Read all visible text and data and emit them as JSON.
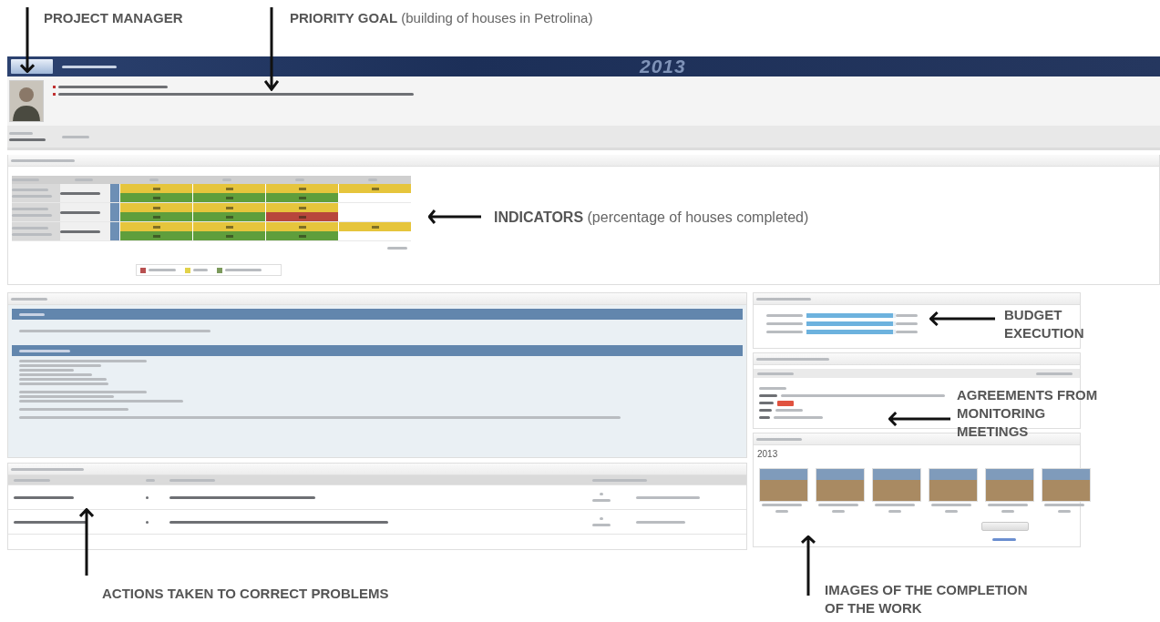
{
  "annotations": [
    {
      "kind": "down",
      "label": "PROJECT MANAGER"
    },
    {
      "kind": "down",
      "label": "PRIORITY GOAL",
      "detail": "(building of houses in Petrolina)"
    },
    {
      "kind": "left",
      "label": "INDICATORS",
      "detail": "(percentage of houses completed)"
    },
    {
      "kind": "left",
      "label": "BUDGET EXECUTION"
    },
    {
      "kind": "left",
      "label": "AGREEMENTS FROM MONITORING MEETINGS"
    },
    {
      "kind": "up",
      "label": "ACTIONS TAKEN TO CORRECT PROBLEMS"
    },
    {
      "kind": "up",
      "label": "IMAGES OF THE COMPLETION OF THE WORK"
    }
  ],
  "header": {
    "year": "2013"
  },
  "indicators": {
    "groups": [
      {
        "lines": [
          {
            "cells": [
              {
                "color": "#e6c53c"
              },
              {
                "color": "#e6c53c"
              },
              {
                "color": "#e6c53c"
              },
              {
                "color": "#e6c53c"
              }
            ]
          },
          {
            "cells": [
              {
                "color": "#5f9e3c"
              },
              {
                "color": "#5f9e3c"
              },
              {
                "color": "#5f9e3c"
              }
            ]
          }
        ]
      },
      {
        "lines": [
          {
            "cells": [
              {
                "color": "#e6c53c"
              },
              {
                "color": "#e6c53c"
              },
              {
                "color": "#e6c53c"
              }
            ]
          },
          {
            "cells": [
              {
                "color": "#5f9e3c"
              },
              {
                "color": "#5f9e3c"
              },
              {
                "color": "#b8463c"
              }
            ]
          }
        ]
      },
      {
        "lines": [
          {
            "cells": [
              {
                "color": "#e6c53c"
              },
              {
                "color": "#e6c53c"
              },
              {
                "color": "#e6c53c"
              },
              {
                "color": "#e6c53c"
              }
            ]
          },
          {
            "cells": [
              {
                "color": "#5f9e3c"
              },
              {
                "color": "#5f9e3c"
              },
              {
                "color": "#5f9e3c"
              }
            ]
          }
        ]
      }
    ],
    "legend": [
      {
        "color": "#b85050"
      },
      {
        "color": "#e2d24a"
      },
      {
        "color": "#7c9a5c"
      }
    ]
  },
  "budget": {
    "bars": [
      {
        "level": 0.97
      },
      {
        "level": 0.97
      },
      {
        "level": 0.97
      }
    ]
  },
  "gallery": {
    "year": "2013"
  }
}
